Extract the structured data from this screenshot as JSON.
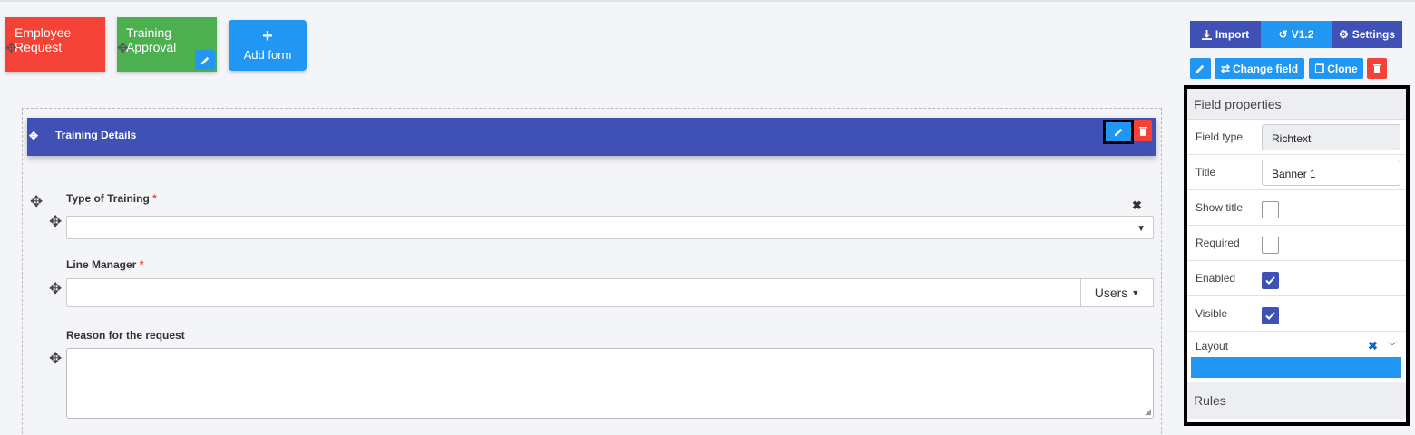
{
  "forms": {
    "tabs": [
      {
        "label": "Employee Request",
        "color": "#f44336"
      },
      {
        "label": "Training Approval",
        "color": "#4caf50"
      }
    ],
    "add_label": "Add form"
  },
  "canvas": {
    "banner_title": "Training Details",
    "fields": [
      {
        "label": "Type of Training",
        "required": "*"
      },
      {
        "label": "Line Manager",
        "required": "*",
        "button": "Users"
      },
      {
        "label": "Reason for the request"
      }
    ]
  },
  "toolbar": {
    "import": "Import",
    "version": "V1.2",
    "settings": "Settings"
  },
  "actions": {
    "change_field": "Change field",
    "clone": "Clone"
  },
  "properties": {
    "header": "Field properties",
    "field_type_label": "Field type",
    "field_type_value": "Richtext",
    "title_label": "Title",
    "title_value": "Banner 1",
    "show_title_label": "Show title",
    "show_title": false,
    "required_label": "Required",
    "required": false,
    "enabled_label": "Enabled",
    "enabled": true,
    "visible_label": "Visible",
    "visible": true,
    "layout_label": "Layout",
    "rules_header": "Rules"
  },
  "colors": {
    "primary": "#3f51b5",
    "accent": "#2196f3",
    "danger": "#f44336",
    "success": "#4caf50"
  }
}
